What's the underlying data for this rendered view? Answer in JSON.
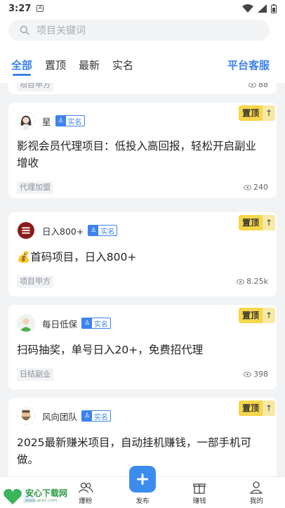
{
  "status": {
    "time": "3:27"
  },
  "search": {
    "placeholder": "项目关键词"
  },
  "tabs": [
    {
      "label": "全部",
      "active": true
    },
    {
      "label": "置顶",
      "active": false
    },
    {
      "label": "最新",
      "active": false
    },
    {
      "label": "实名",
      "active": false
    }
  ],
  "service_label": "平台客服",
  "partial_top_card": {
    "tag": "项目甲方",
    "views": "88"
  },
  "verify_label": "实名",
  "pin": {
    "label": "置顶",
    "arrow": "↑"
  },
  "cards": [
    {
      "user": "星",
      "avatar": "girl-avatar",
      "title": "影视会员代理项目：低投入高回报，轻松开启副业增收",
      "tag": "代理加盟",
      "views": "240"
    },
    {
      "user": "日入800+",
      "avatar": "seal-avatar",
      "title": "💰首码项目，日入800+",
      "tag": "项目甲方",
      "views": "8.25k"
    },
    {
      "user": "每日低保",
      "avatar": "person-avatar",
      "title": "扫码抽奖，单号日入20+，免费招代理",
      "tag": "日结副业",
      "views": "398"
    },
    {
      "user": "风向团队",
      "avatar": "bearded-man-avatar",
      "title": "2025最新赚米项目，自动挂机赚钱，一部手机可做。",
      "tag": "",
      "views": ""
    }
  ],
  "nav": [
    {
      "label": "",
      "icon": "home-icon"
    },
    {
      "label": "爆粉",
      "icon": "users-icon"
    },
    {
      "label": "发布",
      "icon": "plus-icon"
    },
    {
      "label": "赚钱",
      "icon": "gift-icon"
    },
    {
      "label": "我的",
      "icon": "profile-icon"
    }
  ],
  "watermark": {
    "main": "安心下载网",
    "sub": "www.anxz.com",
    "badge": "安心"
  },
  "colors": {
    "accent": "#3c82f0",
    "pin": "#f7d64a",
    "green": "#2e9b44"
  }
}
